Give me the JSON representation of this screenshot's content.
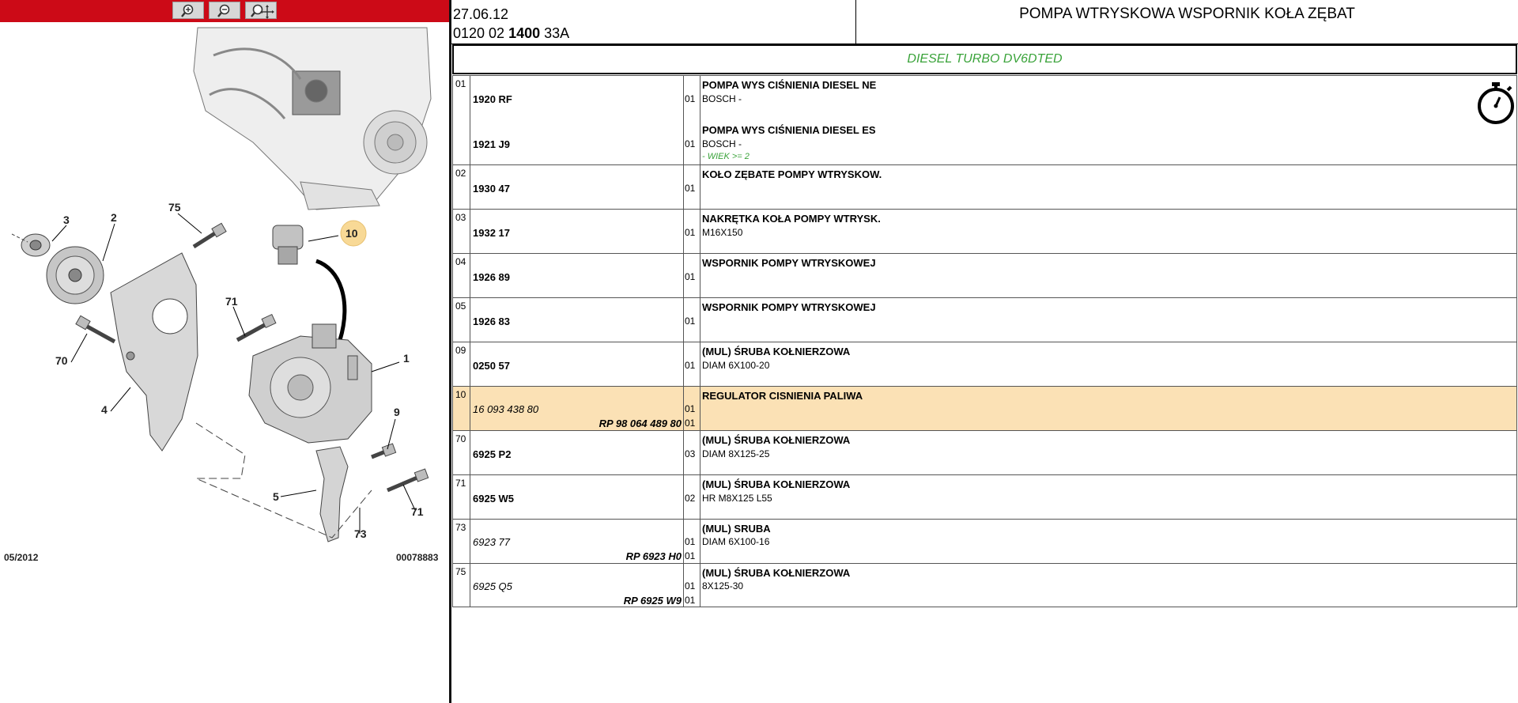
{
  "toolbar": {
    "buttons": [
      {
        "name": "zoom-in-button",
        "icon": "zoom-in-icon"
      },
      {
        "name": "zoom-out-button",
        "icon": "zoom-out-icon"
      },
      {
        "name": "pan-zoom-button",
        "icon": "pan-zoom-icon"
      }
    ],
    "bg_color": "#cc0a17"
  },
  "diagram": {
    "date": "05/2012",
    "id": "00078883",
    "callouts": [
      "3",
      "2",
      "75",
      "10",
      "71",
      "70",
      "1",
      "4",
      "9",
      "5",
      "73",
      "71"
    ]
  },
  "header": {
    "date": "27.06.12",
    "code_prefix": "0120 02",
    "code_bold": "1400",
    "code_suffix": "33A",
    "title": "POMPA WTRYSKOWA WSPORNIK KOŁA ZĘBAT"
  },
  "engine": "DIESEL TURBO DV6DTED",
  "parts": [
    {
      "ref": "01",
      "items": [
        {
          "pn": "1920 RF",
          "qty": "01",
          "desc": "POMPA WYS CIŚNIENIA DIESEL NE",
          "sub": "BOSCH -"
        },
        {
          "pn": "1921 J9",
          "qty": "01",
          "desc": "POMPA WYS CIŚNIENIA DIESEL ES",
          "sub": "BOSCH -",
          "cond": "- WIEK >= 2"
        }
      ]
    },
    {
      "ref": "02",
      "pn": "1930 47",
      "qty": "01",
      "desc": "KOŁO ZĘBATE POMPY WTRYSKOW.",
      "sub": ""
    },
    {
      "ref": "03",
      "pn": "1932 17",
      "qty": "01",
      "desc": "NAKRĘTKA KOŁA POMPY WTRYSK.",
      "sub": "M16X150"
    },
    {
      "ref": "04",
      "pn": "1926 89",
      "qty": "01",
      "desc": "WSPORNIK POMPY WTRYSKOWEJ",
      "sub": ""
    },
    {
      "ref": "05",
      "pn": "1926 83",
      "qty": "01",
      "desc": "WSPORNIK POMPY WTRYSKOWEJ",
      "sub": ""
    },
    {
      "ref": "09",
      "pn": "0250 57",
      "qty": "01",
      "desc": "(MUL) ŚRUBA KOŁNIERZOWA",
      "sub": "DIAM 6X100-20"
    },
    {
      "ref": "10",
      "pn": "16 093 438 80",
      "pn_italic": true,
      "qty": "01",
      "rp": "RP 98 064 489 80",
      "rp_qty": "01",
      "desc": "REGULATOR CISNIENIA PALIWA",
      "sub": "",
      "highlight": true
    },
    {
      "ref": "70",
      "pn": "6925 P2",
      "qty": "03",
      "desc": "(MUL) ŚRUBA KOŁNIERZOWA",
      "sub": "DIAM 8X125-25"
    },
    {
      "ref": "71",
      "pn": "6925 W5",
      "qty": "02",
      "desc": "(MUL) ŚRUBA KOŁNIERZOWA",
      "sub": "HR M8X125 L55"
    },
    {
      "ref": "73",
      "pn": "6923 77",
      "pn_italic": true,
      "qty": "01",
      "rp": "RP 6923 H0",
      "rp_qty": "01",
      "desc": "(MUL) SRUBA",
      "sub": "DIAM 6X100-16"
    },
    {
      "ref": "75",
      "pn": "6925 Q5",
      "pn_italic": true,
      "qty": "01",
      "rp": "RP 6925 W9",
      "rp_qty": "01",
      "desc": "(MUL) ŚRUBA KOŁNIERZOWA",
      "sub": "8X125-30"
    }
  ],
  "icons": {
    "timer": "stopwatch-icon"
  },
  "colors": {
    "accent_green": "#3aa33a",
    "highlight_row": "#fbe1b5",
    "callout_fill": "#f8d996"
  }
}
